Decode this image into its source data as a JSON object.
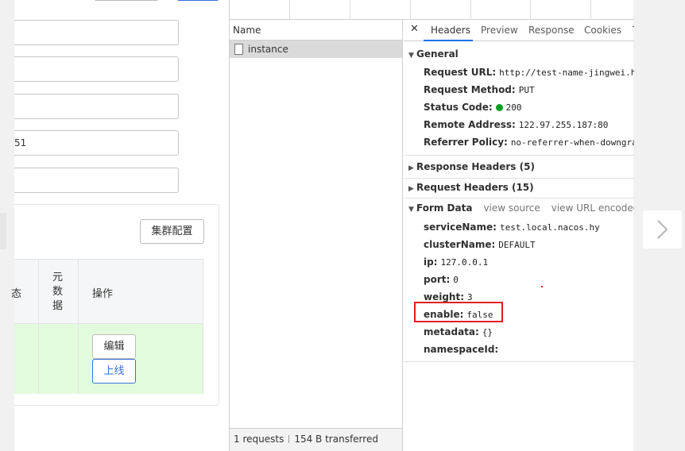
{
  "app_form": {
    "input_values": [
      "",
      "",
      "",
      "51",
      ""
    ],
    "cluster_config_label": "集群配置",
    "table": {
      "col_partial_label": "态",
      "metadata_header": "元数据",
      "actions_header": "操作",
      "edit_label": "编辑",
      "online_label": "上线"
    }
  },
  "devtools": {
    "name_column_header": "Name",
    "request_name": "instance",
    "summary": {
      "requests": "1 requests",
      "transferred": "154 B transferred"
    },
    "tabs": [
      "Headers",
      "Preview",
      "Response",
      "Cookies",
      "T"
    ],
    "active_tab": "Headers",
    "general": {
      "title": "General",
      "rows": [
        {
          "key": "Request URL:",
          "value": "http://test-name-jingwei.huy"
        },
        {
          "key": "Request Method:",
          "value": "PUT"
        },
        {
          "key": "Status Code:",
          "value": "200"
        },
        {
          "key": "Remote Address:",
          "value": "122.97.255.187:80"
        },
        {
          "key": "Referrer Policy:",
          "value": "no-referrer-when-downgrade"
        }
      ]
    },
    "response_headers": "Response Headers (5)",
    "request_headers": "Request Headers (15)",
    "form_data": {
      "title": "Form Data",
      "view_source": "view source",
      "view_url_encoded": "view URL encoded",
      "rows": [
        {
          "key": "serviceName:",
          "value": "test.local.nacos.hy"
        },
        {
          "key": "clusterName:",
          "value": "DEFAULT"
        },
        {
          "key": "ip:",
          "value": "127.0.0.1"
        },
        {
          "key": "port:",
          "value": "0"
        },
        {
          "key": "weight:",
          "value": "3"
        },
        {
          "key": "enable:",
          "value": "false"
        },
        {
          "key": "metadata:",
          "value": "{}"
        },
        {
          "key": "namespaceId:",
          "value": ""
        }
      ]
    }
  },
  "colors": {
    "accent_blue": "#1a73e8",
    "status_green": "#0a9e24",
    "highlight_red": "#e02020",
    "row_green": "#e2fbdc",
    "online_button": "#3a6fd8"
  },
  "icons": {
    "close": "close-icon",
    "expanded": "triangle-down-icon",
    "collapsed": "triangle-right-icon",
    "file": "file-icon",
    "next": "chevron-right-icon"
  }
}
